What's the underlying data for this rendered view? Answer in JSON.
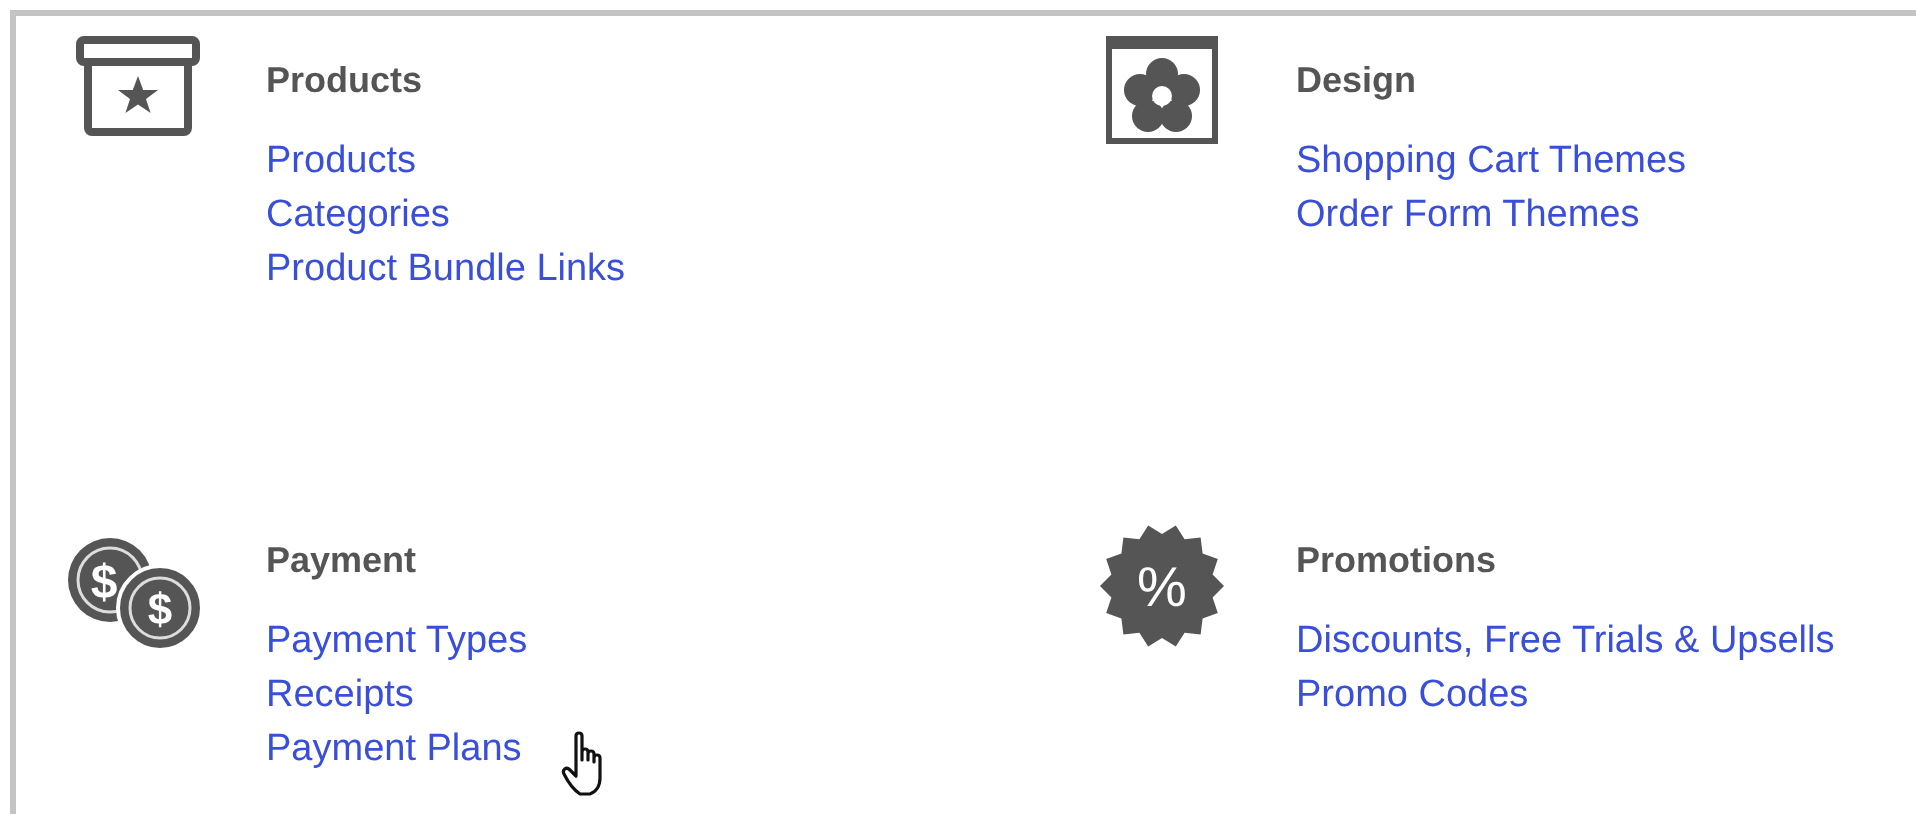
{
  "sections": [
    {
      "kind": "box",
      "title": "Products",
      "links": [
        "Products",
        "Categories",
        "Product Bundle Links"
      ]
    },
    {
      "kind": "flower",
      "title": "Design",
      "links": [
        "Shopping Cart Themes",
        "Order Form Themes"
      ]
    },
    {
      "kind": "coins",
      "icon_texts": [
        "$",
        "$"
      ],
      "title": "Payment",
      "links": [
        "Payment Types",
        "Receipts",
        "Payment Plans"
      ]
    },
    {
      "kind": "badge",
      "icon_texts": [
        "%"
      ],
      "title": "Promotions",
      "links": [
        "Discounts, Free Trials & Upsells",
        "Promo Codes"
      ]
    }
  ]
}
